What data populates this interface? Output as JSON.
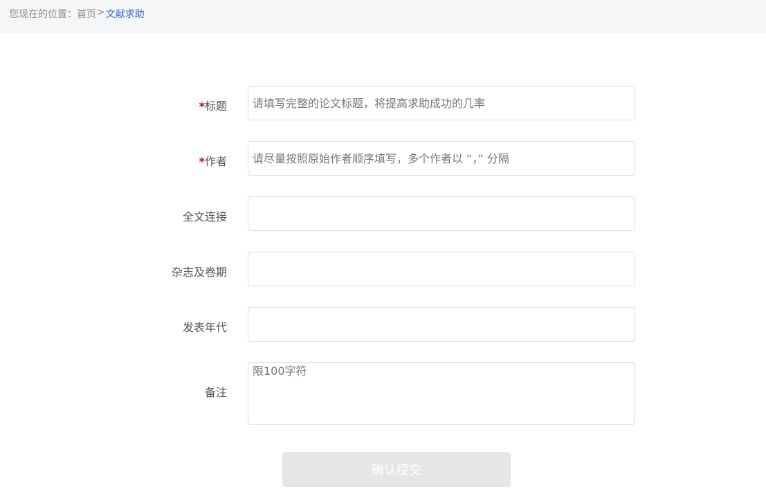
{
  "breadcrumb": {
    "prefix": "您现在的位置：",
    "home": "首页",
    "separator": ">",
    "current": "文献求助"
  },
  "form": {
    "title": {
      "star": "*",
      "label": "标题",
      "placeholder": "请填写完整的论文标题，将提高求助成功的几率"
    },
    "author": {
      "star": "*",
      "label": "作者",
      "placeholder": "请尽量按照原始作者顺序填写，多个作者以 “，” 分隔"
    },
    "fulltext_link": {
      "label": "全文连接",
      "placeholder": ""
    },
    "journal_volume": {
      "label": "杂志及卷期",
      "placeholder": ""
    },
    "publish_year": {
      "label": "发表年代",
      "placeholder": ""
    },
    "remarks": {
      "label": "备注",
      "placeholder": "限100字符"
    },
    "submit_label": "确认提交"
  },
  "colors": {
    "breadcrumb_bg": "#f5f6f8",
    "current_link": "#3a66c4",
    "required": "#d0021b",
    "button_disabled": "#e6e6e6"
  }
}
